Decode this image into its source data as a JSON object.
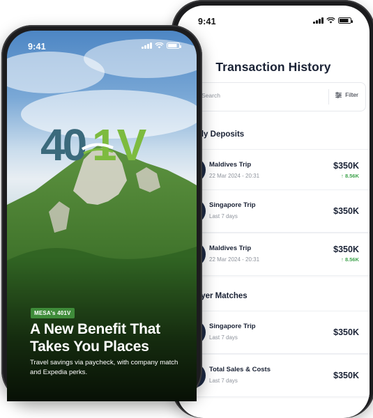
{
  "transaction_screen": {
    "status_time": "9:41",
    "title": "Transaction History",
    "search_placeholder": "Search",
    "filter_label": "Filter",
    "sections": [
      {
        "title": "thly Deposits",
        "items": [
          {
            "name": "Maldives Trip",
            "sub": "22 Mar 2024 - 20:31",
            "amount": "$350K",
            "delta": "↑ 8.56K"
          },
          {
            "name": "Singapore Trip",
            "sub": "Last 7 days",
            "amount": "$350K",
            "delta": ""
          },
          {
            "name": "Maldives Trip",
            "sub": "22 Mar 2024 - 20:31",
            "amount": "$350K",
            "delta": "↑ 8.56K"
          }
        ]
      },
      {
        "title": "loyer Matches",
        "items": [
          {
            "name": "Singapore Trip",
            "sub": "Last 7 days",
            "amount": "$350K",
            "delta": ""
          },
          {
            "name": "Total Sales & Costs",
            "sub": "Last 7 days",
            "amount": "$350K",
            "delta": ""
          }
        ]
      }
    ]
  },
  "promo_screen": {
    "status_time": "9:41",
    "logo_text": "401V",
    "badge": "MESA's 401V",
    "headline": "A New Benefit That Takes You Places",
    "description": "Travel savings via paycheck, with company match and Expedia perks.",
    "colors": {
      "logo_blue": "#3b6a7c",
      "logo_green": "#7dbb3f",
      "badge_green": "#3f8c3a",
      "positive": "#3fa34d"
    }
  }
}
